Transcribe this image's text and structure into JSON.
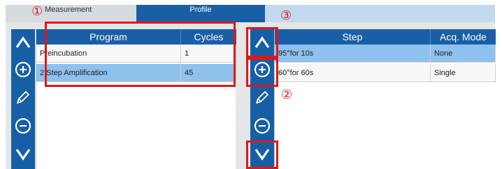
{
  "tabs": {
    "measurement": "Measurement",
    "profile": "Profile"
  },
  "program_table": {
    "headers": {
      "program": "Program",
      "cycles": "Cycles"
    },
    "rows": [
      {
        "program": "Preincubation",
        "cycles": "1"
      },
      {
        "program": "2 Step Amplification",
        "cycles": "45"
      }
    ],
    "selected_row": 1
  },
  "step_table": {
    "headers": {
      "step": "Step",
      "acq_mode": "Acq. Mode"
    },
    "rows": [
      {
        "step": "95°for 10s",
        "acq_mode": "None"
      },
      {
        "step": "60°for 60s",
        "acq_mode": "Single"
      }
    ],
    "selected_row": 0
  },
  "toolbar_icons": [
    "chevron-up-icon",
    "plus-circle-icon",
    "pencil-icon",
    "minus-circle-icon",
    "chevron-down-icon"
  ],
  "callouts": {
    "one": "①",
    "two": "②",
    "three": "③"
  },
  "colors": {
    "accent_blue": "#1a5fa6",
    "selected_row": "#8ec1ee",
    "highlight_red": "#e11717"
  }
}
